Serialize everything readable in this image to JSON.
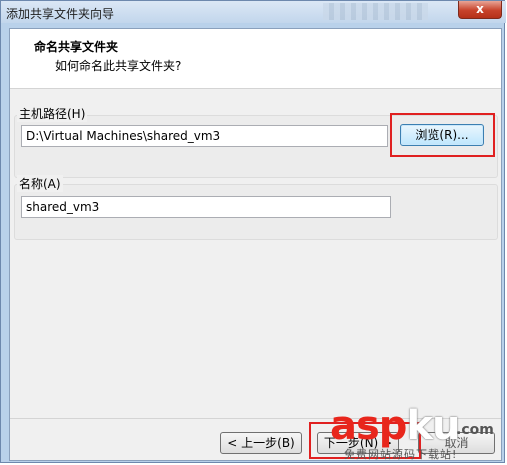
{
  "window": {
    "title": "添加共享文件夹向导",
    "close_glyph": "x"
  },
  "header": {
    "title": "命名共享文件夹",
    "subtitle": "如何命名此共享文件夹?"
  },
  "host_path": {
    "label": "主机路径(H)",
    "value": "D:\\Virtual Machines\\shared_vm3",
    "browse_button": "浏览(R)..."
  },
  "name": {
    "label": "名称(A)",
    "value": "shared_vm3"
  },
  "footer": {
    "back_button": "< 上一步(B)",
    "next_button": "下一步(N) >",
    "cancel_button": "取消"
  },
  "watermark": {
    "text_main": "asp",
    "text_ku": "ku",
    "text_com": ".com",
    "subtext": "免费网站源码下载站!"
  },
  "highlight_color": "#e02020"
}
